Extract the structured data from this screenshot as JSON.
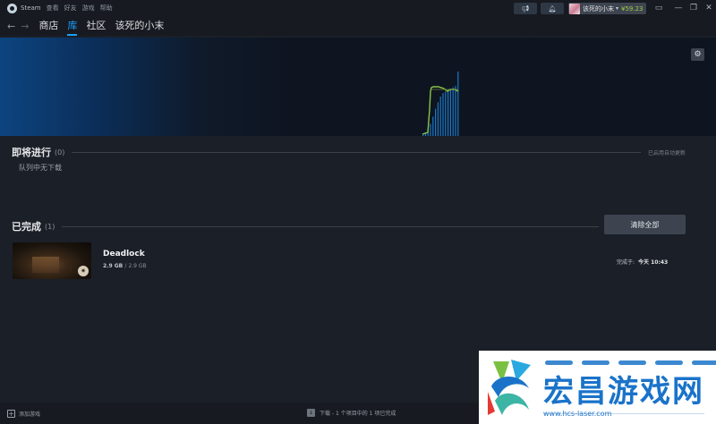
{
  "menubar": {
    "app": "Steam",
    "items": [
      "查看",
      "好友",
      "游戏",
      "帮助"
    ],
    "user_name": "该死的小末",
    "wallet": "¥59.23"
  },
  "nav": {
    "links": [
      "商店",
      "库",
      "社区",
      "该死的小末"
    ],
    "active_index": 1
  },
  "graph": {
    "bars": [
      0.02,
      0.05,
      0.1,
      0.17,
      0.27,
      0.38,
      0.47,
      0.55,
      0.6,
      0.62,
      0.64,
      0.66,
      0.68,
      0.7,
      0.9
    ],
    "colors": {
      "bars": "#1a78c8",
      "line": "#8bc34a",
      "line_faint": "#5f7d38"
    }
  },
  "upcoming": {
    "title": "即将进行",
    "count": "(0)",
    "right_note": "已启用自动更新",
    "empty_text": "队列中无下载"
  },
  "completed": {
    "title": "已完成",
    "count": "(1)",
    "clear_label": "清除全部",
    "items": [
      {
        "name": "Deadlock",
        "downloaded": "2.9 GB",
        "separator": "/",
        "total": "2.9 GB",
        "done_label": "完成于:",
        "done_time": "今天 10:43"
      }
    ]
  },
  "bottombar": {
    "add_game": "添加游戏",
    "status": "下载 - 1 个项目中的 1 项已完成"
  },
  "watermark": {
    "title": "宏昌游戏网",
    "url": "www.hcs-laser.com"
  }
}
